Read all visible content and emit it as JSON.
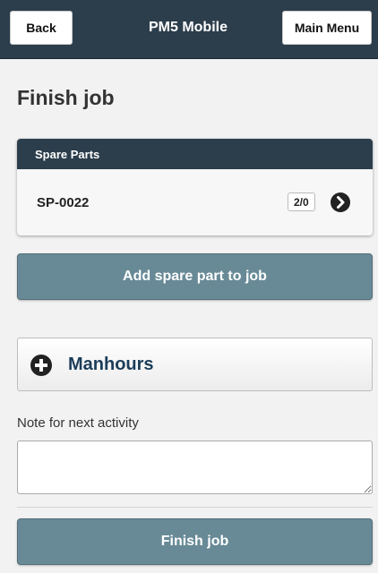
{
  "header": {
    "back_label": "Back",
    "title": "PM5 Mobile",
    "menu_label": "Main Menu"
  },
  "page": {
    "title": "Finish job"
  },
  "spare_parts": {
    "heading": "Spare Parts",
    "items": [
      {
        "id": "SP-0022",
        "count": "2/0"
      }
    ]
  },
  "buttons": {
    "add_spare_part": "Add spare part to job",
    "finish_job": "Finish job"
  },
  "manhours": {
    "label": "Manhours",
    "icon": "plus-circle-icon"
  },
  "note": {
    "label": "Note for next activity",
    "value": ""
  },
  "colors": {
    "header_bg": "#2c3e4c",
    "button_bg": "#688a96",
    "manhours_text": "#1c3d5a"
  }
}
